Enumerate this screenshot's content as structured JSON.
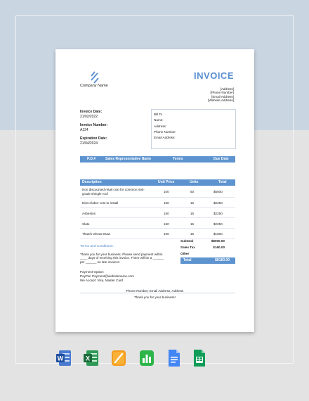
{
  "invoice": {
    "title": "INVOICE",
    "company_name": "Company Name",
    "address_lines": [
      "[Address]",
      "[Phone Number]",
      "[Email Address]",
      "[Website Address]"
    ],
    "invoice_date_label": "Invoice Date:",
    "invoice_date": "21/02/2022",
    "invoice_number_label": "Invoice Number:",
    "invoice_number": "A124",
    "expiration_date_label": "Expiration Date:",
    "expiration_date": "21/04/2024",
    "bill_to": [
      "Bill To",
      "Name:",
      "Address:",
      "Phone Number",
      "Email Address:"
    ],
    "po_headers": [
      "P.O.#",
      "Sales Representative Name",
      "Terms",
      "Due Date"
    ],
    "item_headers": [
      "Description",
      "Unit Price",
      "Units",
      "Total"
    ],
    "items": [
      {
        "description_line1": "Non discounted retail cost for common mid-",
        "description_line2": "grade shingle roof",
        "unit_price": "100",
        "units": "50",
        "total": "$5000"
      },
      {
        "description_line1": "Direct labor cost to install",
        "description_line2": "",
        "unit_price": "150",
        "units": "15",
        "total": "$2250"
      },
      {
        "description_line1": "Asbestos",
        "description_line2": "",
        "unit_price": "150",
        "units": "15",
        "total": "$2250"
      },
      {
        "description_line1": "Slate",
        "description_line2": "",
        "unit_price": "150",
        "units": "15",
        "total": "$2250"
      },
      {
        "description_line1": "Thatch-wheat straw",
        "description_line2": "",
        "unit_price": "100",
        "units": "15",
        "total": "$1000"
      }
    ],
    "terms_heading": "Terms and Conditions:",
    "terms_lines": [
      "Thank you for your business. Please send payment within",
      "____ days of receiving this invoice. There will be a ______",
      "per ______ on late invoices"
    ],
    "payment_lines": [
      "Payment Option:",
      "PayPal: Payment@websitename.com",
      "We Accept: Visa, Master Card"
    ],
    "subtotal_label": "Subtotal",
    "subtotal": "$8000.00",
    "sales_tax_label": "Sales Tax",
    "sales_tax": "$160.00",
    "other_label": "Other",
    "total_label": "Total",
    "total": "$8160.00",
    "footer_contact": "Phone Number, Email Address, Address",
    "footer_thanks": "Thank you for your business!"
  },
  "colors": {
    "accent": "#5d93cf",
    "background_top": "#c9d6e2",
    "background_bottom": "#e3e3e3"
  },
  "app_icons": [
    "word-icon",
    "excel-icon",
    "pages-icon",
    "numbers-icon",
    "google-docs-icon",
    "google-sheets-icon"
  ]
}
